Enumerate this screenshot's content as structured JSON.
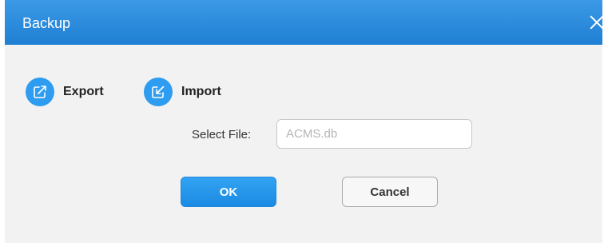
{
  "dialog": {
    "title": "Backup",
    "close_icon": "close-icon"
  },
  "actions": {
    "export": {
      "label": "Export",
      "icon": "export-icon"
    },
    "import": {
      "label": "Import",
      "icon": "import-icon"
    }
  },
  "select_file": {
    "label": "Select File:",
    "placeholder": "ACMS.db",
    "value": ""
  },
  "buttons": {
    "ok": "OK",
    "cancel": "Cancel"
  },
  "colors": {
    "title_bar": "#1f7fd3",
    "accent": "#2e9cf0",
    "body_bg": "#f2f2f2"
  }
}
